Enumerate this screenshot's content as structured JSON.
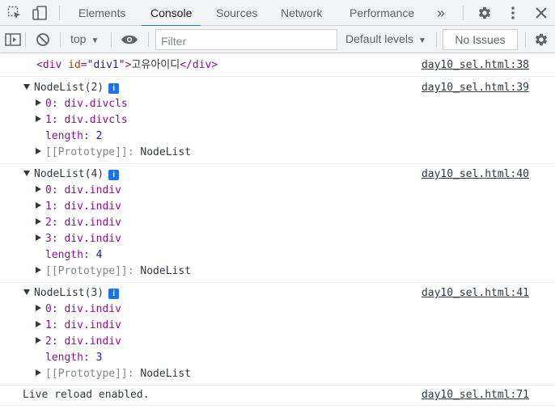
{
  "devtools": {
    "tabs": [
      {
        "label": "Elements"
      },
      {
        "label": "Console"
      },
      {
        "label": "Sources"
      },
      {
        "label": "Network"
      },
      {
        "label": "Performance"
      }
    ],
    "more_tabs": "»",
    "active_tab": "Console",
    "accent_color": "#1a73e8"
  },
  "toolbar": {
    "context": "top",
    "filter_placeholder": "Filter",
    "levels": "Default levels",
    "issues": "No Issues"
  },
  "console": {
    "entries": [
      {
        "tag_open": "<div ",
        "attr_name": "id",
        "eq": "=",
        "attr_value": "\"div1\"",
        "gt": ">",
        "text": "고유아이디",
        "tag_close": "</div>",
        "source": "day10_sel.html:38"
      },
      {
        "title": "NodeList(2)",
        "source": "day10_sel.html:39",
        "items": [
          {
            "key": "0:",
            "value": "div.divcls"
          },
          {
            "key": "1:",
            "value": "div.divcls"
          }
        ],
        "length_label": "length:",
        "length": "2",
        "proto_label": "[[Prototype]]:",
        "proto_value": "NodeList"
      },
      {
        "title": "NodeList(4)",
        "source": "day10_sel.html:40",
        "items": [
          {
            "key": "0:",
            "value": "div.indiv"
          },
          {
            "key": "1:",
            "value": "div.indiv"
          },
          {
            "key": "2:",
            "value": "div.indiv"
          },
          {
            "key": "3:",
            "value": "div.indiv"
          }
        ],
        "length_label": "length:",
        "length": "4",
        "proto_label": "[[Prototype]]:",
        "proto_value": "NodeList"
      },
      {
        "title": "NodeList(3)",
        "source": "day10_sel.html:41",
        "items": [
          {
            "key": "0:",
            "value": "div.indiv"
          },
          {
            "key": "1:",
            "value": "div.indiv"
          },
          {
            "key": "2:",
            "value": "div.indiv"
          }
        ],
        "length_label": "length:",
        "length": "3",
        "proto_label": "[[Prototype]]:",
        "proto_value": "NodeList"
      },
      {
        "text": "Live reload enabled.",
        "source": "day10_sel.html:71"
      }
    ],
    "info_badge": "i"
  },
  "icons": {
    "inspect": "inspect-element-icon",
    "device": "device-toolbar-icon",
    "sidebar": "console-sidebar-icon",
    "clear": "clear-console-icon",
    "eye": "live-expression-icon",
    "settings": "settings-gear-icon",
    "more": "more-vert-icon",
    "close": "close-icon"
  }
}
